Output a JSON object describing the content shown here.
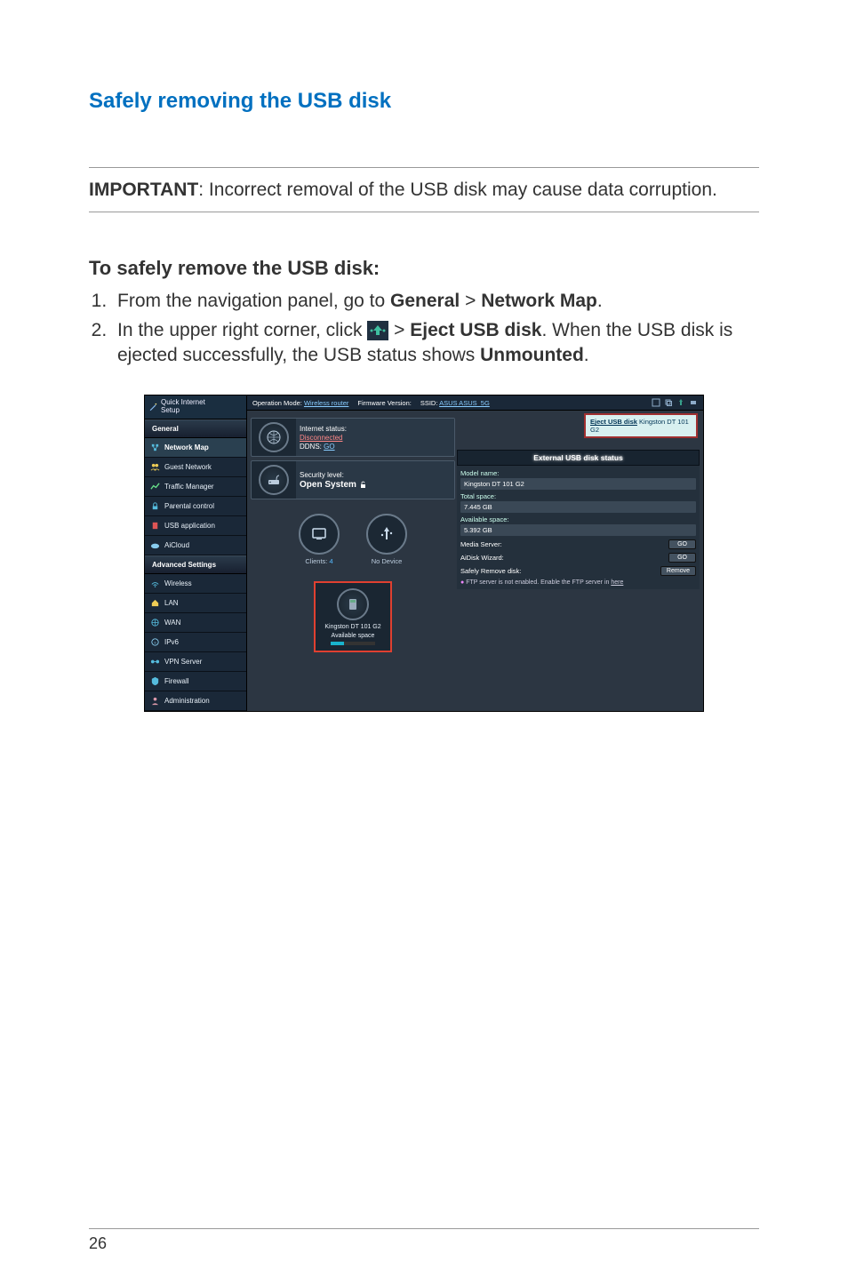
{
  "section_title": "Safely removing the USB disk",
  "important": {
    "label": "IMPORTANT",
    "text": ":  Incorrect removal of the USB disk may cause data corruption."
  },
  "subheading": "To safely remove the USB disk:",
  "steps": {
    "s1_a": "From the navigation panel, go to ",
    "s1_b": "General",
    "s1_c": " > ",
    "s1_d": "Network Map",
    "s1_e": ".",
    "s2_a": "In the upper right corner, click ",
    "s2_b": " > ",
    "s2_c": "Eject USB disk",
    "s2_d": ". When the USB disk is ejected successfully, the USB status shows ",
    "s2_e": "Unmounted",
    "s2_f": "."
  },
  "router": {
    "quick_setup": "Quick Internet\nSetup",
    "general_header": "General",
    "advanced_header": "Advanced Settings",
    "general_items": [
      "Network Map",
      "Guest Network",
      "Traffic Manager",
      "Parental control",
      "USB application",
      "AiCloud"
    ],
    "advanced_items": [
      "Wireless",
      "LAN",
      "WAN",
      "IPv6",
      "VPN Server",
      "Firewall",
      "Administration"
    ],
    "topbar": {
      "opmode_lbl": "Operation Mode: ",
      "opmode_val": "Wireless router",
      "fw_lbl": "Firmware Version:",
      "ssid_lbl": "SSID: ",
      "ssid_val": "ASUS  ASUS_5G"
    },
    "eject_popup": {
      "link": "Eject USB disk",
      "text": " Kingston DT 101 G2"
    },
    "status": {
      "inet_lbl": "Internet status:",
      "inet_val": "Disconnected",
      "ddns_lbl": "DDNS: ",
      "ddns_val": "GO",
      "sec_lbl": "Security level:",
      "sec_val": "Open System "
    },
    "clients": {
      "lbl": "Clients: ",
      "val": "4",
      "nodev": "No Device"
    },
    "usbcard": {
      "name": "Kingston DT 101 G2",
      "avail": "Available space"
    },
    "rightpanel": {
      "header": "External USB disk status",
      "model_k": "Model name:",
      "model_v": "Kingston DT 101 G2",
      "total_k": "Total space:",
      "total_v": "7.445 GB",
      "avail_k": "Available space:",
      "avail_v": "5.392 GB",
      "media_k": "Media Server:",
      "aidisk_k": "AiDisk Wizard:",
      "safely_k": "Safely Remove disk:",
      "go": "GO",
      "remove": "Remove",
      "foot": "FTP server is not enabled. Enable the FTP server in ",
      "foot_link": "here"
    }
  },
  "page_number": "26"
}
